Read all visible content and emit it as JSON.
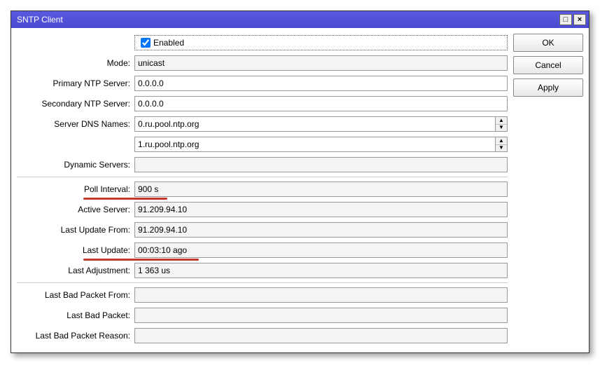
{
  "window": {
    "title": "SNTP Client"
  },
  "buttons": {
    "ok": "OK",
    "cancel": "Cancel",
    "apply": "Apply"
  },
  "labels": {
    "enabled": "Enabled",
    "mode": "Mode:",
    "primary_ntp": "Primary NTP Server:",
    "secondary_ntp": "Secondary NTP Server:",
    "server_dns": "Server DNS Names:",
    "dynamic_servers": "Dynamic Servers:",
    "poll_interval": "Poll Interval:",
    "active_server": "Active Server:",
    "last_update_from": "Last Update From:",
    "last_update": "Last Update:",
    "last_adjustment": "Last Adjustment:",
    "last_bad_packet_from": "Last Bad Packet From:",
    "last_bad_packet": "Last Bad Packet:",
    "last_bad_packet_reason": "Last Bad Packet Reason:"
  },
  "values": {
    "enabled_checked": true,
    "mode": "unicast",
    "primary_ntp": "0.0.0.0",
    "secondary_ntp": "0.0.0.0",
    "server_dns_1": "0.ru.pool.ntp.org",
    "server_dns_2": "1.ru.pool.ntp.org",
    "dynamic_servers": "",
    "poll_interval": "900 s",
    "active_server": "91.209.94.10",
    "last_update_from": "91.209.94.10",
    "last_update": "00:03:10 ago",
    "last_adjustment": "1 363 us",
    "last_bad_packet_from": "",
    "last_bad_packet": "",
    "last_bad_packet_reason": ""
  }
}
